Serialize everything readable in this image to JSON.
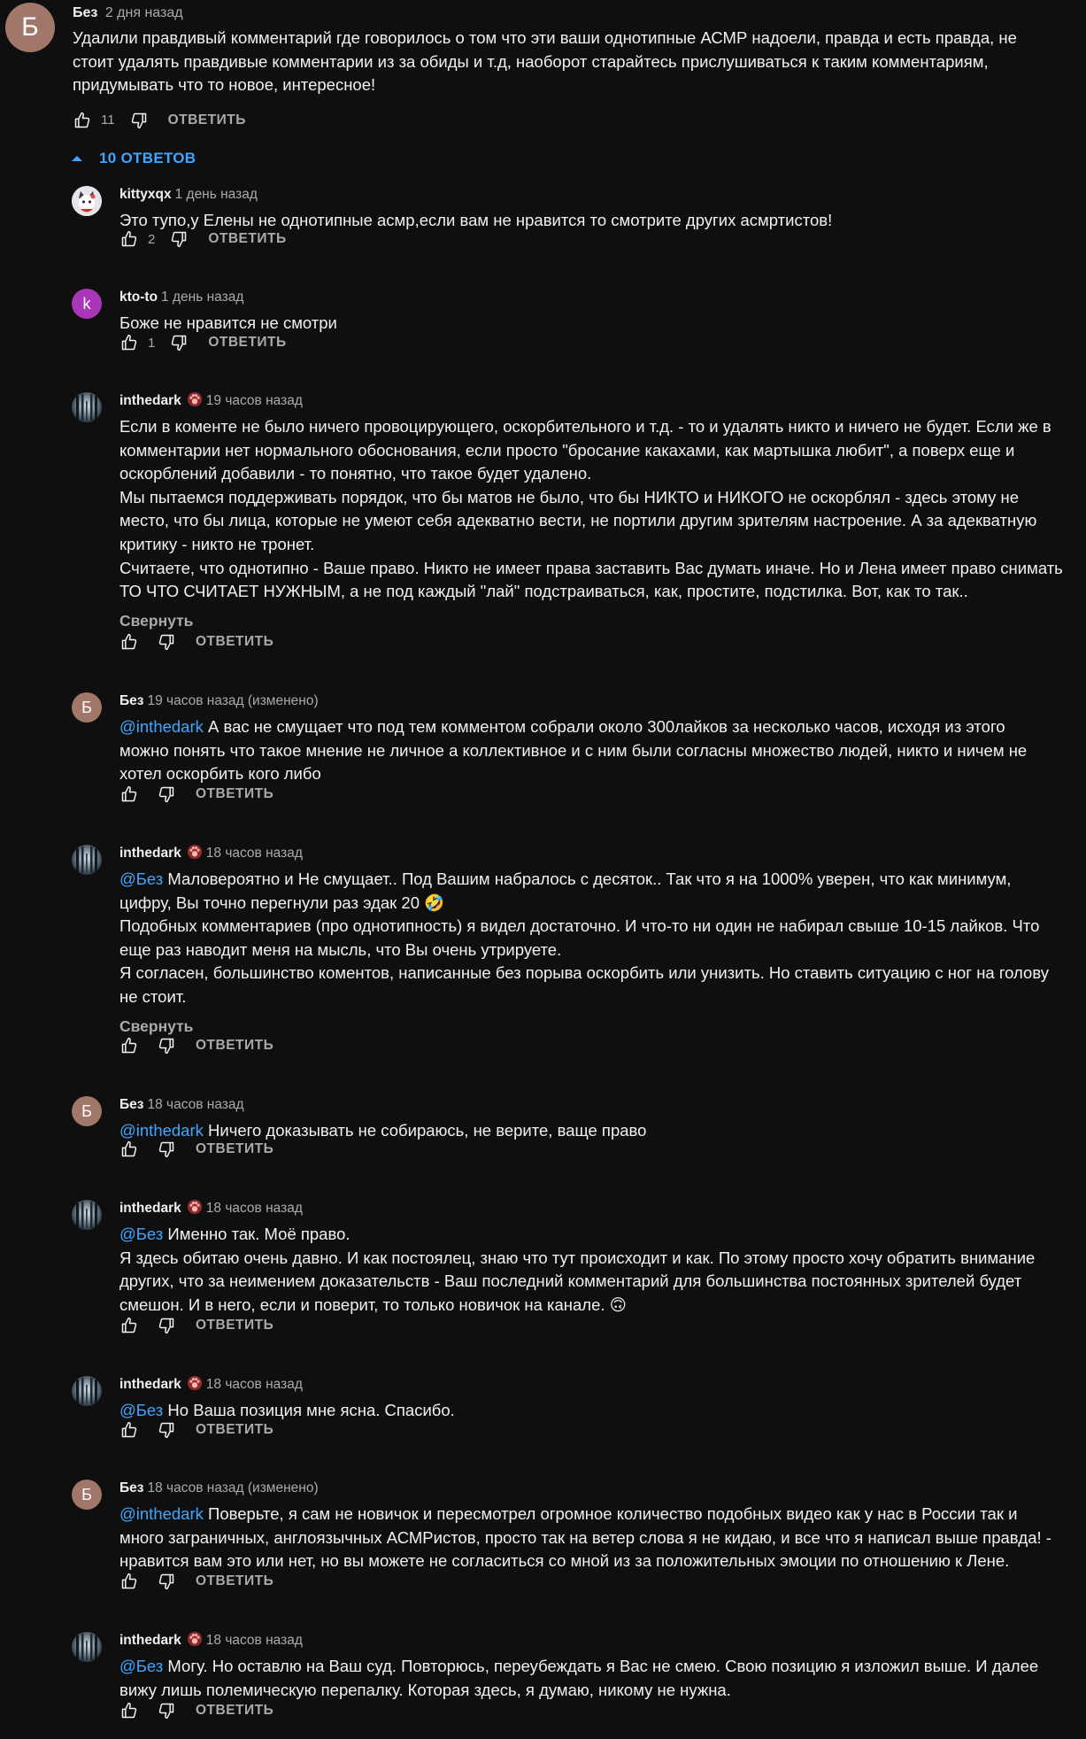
{
  "main": {
    "avatar_letter": "Б",
    "author": "Без",
    "time": "2 дня назад",
    "text": "Удалили правдивый комментарий где говорилось о том что эти ваши однотипные АСМР надоели, правда и есть правда, не\nстоит удалять правдивые комментарии из за обиды и т.д, наоборот старайтесь прислушиваться к таким комментариям,\nпридумывать что то новое, интересное!",
    "likes": "11",
    "reply_label": "ОТВЕТИТЬ"
  },
  "replies_toggle": "10 ОТВЕТОВ",
  "replies": [
    {
      "avatar": "kitty",
      "avatar_letter": "",
      "author": "kittyxqx",
      "badge": false,
      "time": "1 день назад",
      "mention": "",
      "text": "Это тупо,у Елены не однотипные асмр,если вам не нравится то смотрите других асмртистов!",
      "collapse": "",
      "likes": "2",
      "reply_label": "ОТВЕТИТЬ"
    },
    {
      "avatar": "letter-purple",
      "avatar_letter": "k",
      "author": "kto-to",
      "badge": false,
      "time": "1 день назад",
      "mention": "",
      "text": "Боже не нравится не смотри",
      "collapse": "",
      "likes": "1",
      "reply_label": "ОТВЕТИТЬ"
    },
    {
      "avatar": "dark",
      "avatar_letter": "",
      "author": "inthedark",
      "badge": true,
      "time": "19 часов назад",
      "mention": "",
      "text": "Если в коменте не было ничего провоцирующего, оскорбительного и т.д. - то и удалять никто и ничего не будет. Если же в\nкомментарии нет нормального обоснования, если просто \"бросание какахами, как мартышка любит\", а поверх еще и\nоскорблений добавили - то понятно, что такое будет удалено.\nМы пытаемся поддерживать порядок, что бы матов не было, что бы НИКТО и НИКОГО не оскорблял - здесь этому не\nместо, что бы лица, которые не умеют себя адекватно вести, не портили другим зрителям настроение. А за адекватную\nкритику - никто не тронет.\nСчитаете, что однотипно - Ваше право. Никто не имеет права заставить Вас думать иначе. Но и Лена имеет право снимать\nТО ЧТО СЧИТАЕТ НУЖНЫМ, а не под каждый \"лай\" подстраиваться, как, простите, подстилка. Вот, как то так..",
      "collapse": "Свернуть",
      "likes": "",
      "reply_label": "ОТВЕТИТЬ"
    },
    {
      "avatar": "letter-brown",
      "avatar_letter": "Б",
      "author": "Без",
      "badge": false,
      "time": "19 часов назад (изменено)",
      "mention": "@inthedark",
      "text": " А вас не смущает что под тем комментом собрали около 300лайков за несколько часов, исходя из этого\nможно понять что такое мнение не личное а коллективное и с ним были согласны множество людей, никто и ничем не\nхотел оскорбить кого либо",
      "collapse": "",
      "likes": "",
      "reply_label": "ОТВЕТИТЬ"
    },
    {
      "avatar": "dark",
      "avatar_letter": "",
      "author": "inthedark",
      "badge": true,
      "time": "18 часов назад",
      "mention": "@Без",
      "text": " Маловероятно и Не смущает.. Под Вашим набралось с десяток.. Так что я на 1000% уверен, что как минимум,\nцифру, Вы точно перегнули раз эдак 20 🤣\nПодобных комментариев (про однотипность) я видел достаточно. И что-то ни один не набирал свыше 10-15 лайков. Что\nеще раз наводит меня на мысль, что Вы очень утрируете.\nЯ согласен, большинство коментов, написанные без порыва оскорбить или унизить. Но ставить ситуацию с ног на голову\nне стоит.",
      "collapse": "Свернуть",
      "likes": "",
      "reply_label": "ОТВЕТИТЬ"
    },
    {
      "avatar": "letter-brown",
      "avatar_letter": "Б",
      "author": "Без",
      "badge": false,
      "time": "18 часов назад",
      "mention": "@inthedark",
      "text": " Ничего доказывать не собираюсь, не верите, ваще право",
      "collapse": "",
      "likes": "",
      "reply_label": "ОТВЕТИТЬ"
    },
    {
      "avatar": "dark",
      "avatar_letter": "",
      "author": "inthedark",
      "badge": true,
      "time": "18 часов назад",
      "mention": "@Без",
      "text": " Именно так. Моё право.\nЯ здесь обитаю очень давно. И как постоялец, знаю что тут происходит и как. По этому просто хочу обратить внимание\nдругих, что за неимением доказательств - Ваш последний комментарий для большинства постоянных зрителей будет\nсмешон. И в него, если и поверит, то только новичок на канале. 🙃",
      "collapse": "",
      "likes": "",
      "reply_label": "ОТВЕТИТЬ"
    },
    {
      "avatar": "dark",
      "avatar_letter": "",
      "author": "inthedark",
      "badge": true,
      "time": "18 часов назад",
      "mention": "@Без",
      "text": " Но Ваша позиция мне ясна. Спасибо.",
      "collapse": "",
      "likes": "",
      "reply_label": "ОТВЕТИТЬ"
    },
    {
      "avatar": "letter-brown",
      "avatar_letter": "Б",
      "author": "Без",
      "badge": false,
      "time": "18 часов назад (изменено)",
      "mention": "@inthedark",
      "text": " Поверьте, я сам не новичок и пересмотрел огромное количество подобных видео как у нас в России так и\nмного заграничных, англоязычных АСМРистов, просто так на ветер слова я не кидаю, и все что я написал выше правда! -\nнравится вам это или нет, но вы можете не согласиться со мной из за положительных эмоции по отношению к Лене.",
      "collapse": "",
      "likes": "",
      "reply_label": "ОТВЕТИТЬ"
    },
    {
      "avatar": "dark",
      "avatar_letter": "",
      "author": "inthedark",
      "badge": true,
      "time": "18 часов назад",
      "mention": "@Без",
      "text": " Могу. Но оставлю на Ваш суд. Повторюсь, переубеждать я Вас не смею. Свою позицию я изложил выше. И далее\nвижу лишь полемическую перепалку. Которая здесь, я думаю, никому не нужна.",
      "collapse": "",
      "likes": "",
      "reply_label": "ОТВЕТИТЬ"
    }
  ]
}
